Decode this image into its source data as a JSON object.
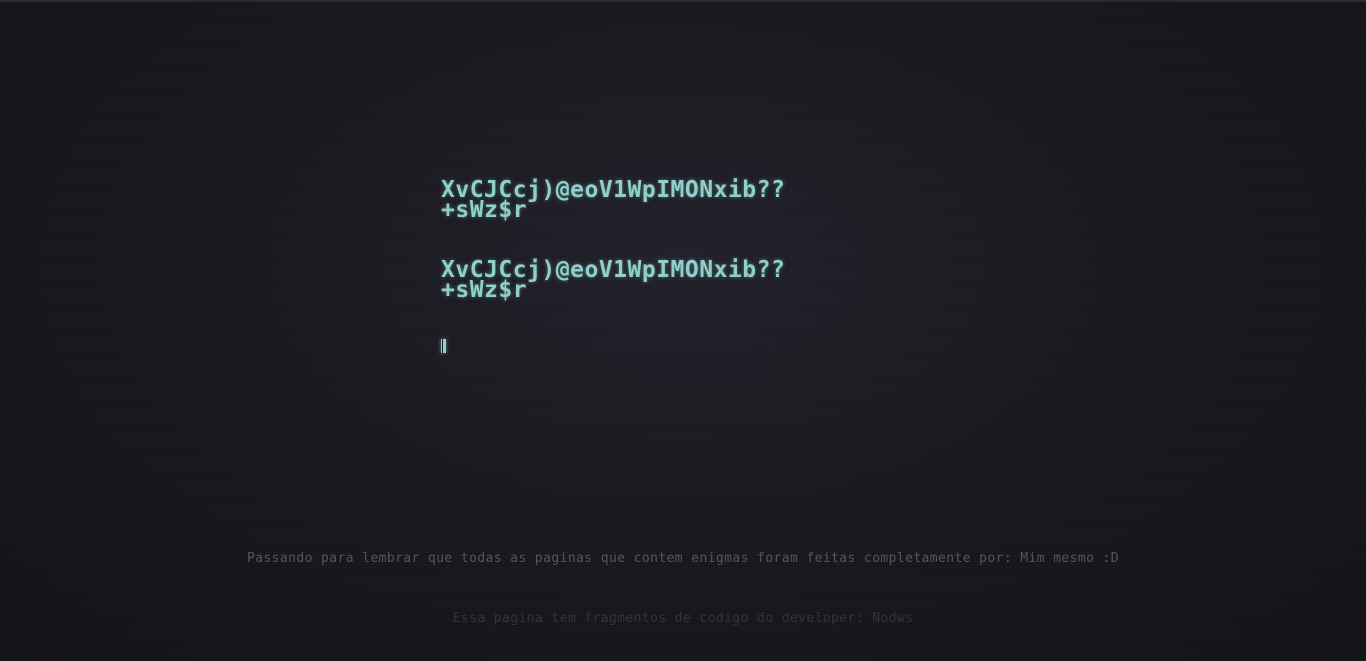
{
  "terminal": {
    "blocks": [
      {
        "line1": "XvCJCcj)@eoV1WpIMONxib??",
        "line2": "+sWz$r"
      },
      {
        "line1": "XvCJCcj)@eoV1WpIMONxib??",
        "line2": "+sWz$r"
      }
    ]
  },
  "footer": {
    "note": "Passando para lembrar que todas as paginas que contem enigmas foram feitas completamente por: Mim mesmo :D",
    "credit": "Essa pagina tem fragmentos de codigo do developer: Nodws"
  },
  "colors": {
    "text": "#8fd0cc",
    "background": "#1a1920"
  }
}
